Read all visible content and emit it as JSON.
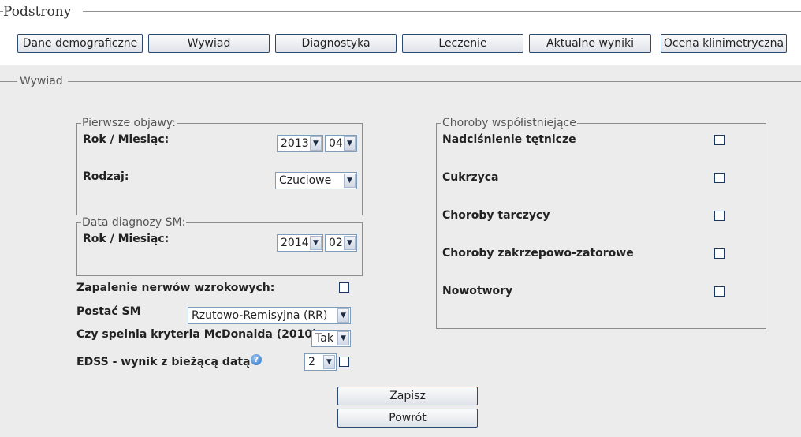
{
  "podstrony": {
    "legend": "Podstrony",
    "buttons": [
      "Dane demograficzne",
      "Wywiad",
      "Diagnostyka",
      "Leczenie",
      "Aktualne wyniki",
      "Ocena klinimetryczna"
    ]
  },
  "wywiad": {
    "legend": "Wywiad",
    "pierwsze_objawy": {
      "legend": "Pierwsze objawy:",
      "rok_miesiac_label": "Rok / Miesiąc:",
      "year": "2013",
      "month": "04",
      "rodzaj_label": "Rodzaj:",
      "rodzaj_value": "Czuciowe"
    },
    "data_diagnozy": {
      "legend": "Data diagnozy SM:",
      "rok_miesiac_label": "Rok / Miesiąc:",
      "year": "2014",
      "month": "02"
    },
    "zapalenie_label": "Zapalenie nerwów wzrokowych:",
    "postac_label": "Postać SM",
    "postac_value": "Rzutowo-Remisyjna (RR)",
    "mcdonald_label": "Czy spelnia kryteria McDonalda (2010)",
    "mcdonald_value": "Tak",
    "edss_label": "EDSS - wynik z bieżącą datą",
    "edss_value": "2",
    "choroby": {
      "legend": "Choroby współistniejące",
      "items": [
        "Nadciśnienie tętnicze",
        "Cukrzyca",
        "Choroby tarczycy",
        "Choroby zakrzepowo-zatorowe",
        "Nowotwory"
      ]
    }
  },
  "actions": {
    "save": "Zapisz",
    "back": "Powrót"
  }
}
